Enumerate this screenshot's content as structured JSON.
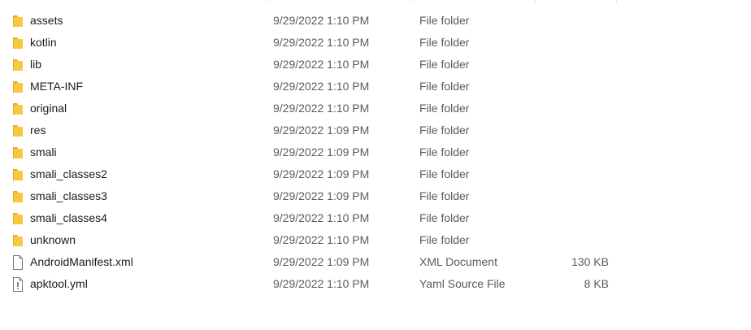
{
  "files": [
    {
      "icon": "folder-icon",
      "name": "assets",
      "date": "9/29/2022 1:10 PM",
      "type": "File folder",
      "size": ""
    },
    {
      "icon": "folder-icon",
      "name": "kotlin",
      "date": "9/29/2022 1:10 PM",
      "type": "File folder",
      "size": ""
    },
    {
      "icon": "folder-icon",
      "name": "lib",
      "date": "9/29/2022 1:10 PM",
      "type": "File folder",
      "size": ""
    },
    {
      "icon": "folder-icon",
      "name": "META-INF",
      "date": "9/29/2022 1:10 PM",
      "type": "File folder",
      "size": ""
    },
    {
      "icon": "folder-icon",
      "name": "original",
      "date": "9/29/2022 1:10 PM",
      "type": "File folder",
      "size": ""
    },
    {
      "icon": "folder-icon",
      "name": "res",
      "date": "9/29/2022 1:09 PM",
      "type": "File folder",
      "size": ""
    },
    {
      "icon": "folder-icon",
      "name": "smali",
      "date": "9/29/2022 1:09 PM",
      "type": "File folder",
      "size": ""
    },
    {
      "icon": "folder-icon",
      "name": "smali_classes2",
      "date": "9/29/2022 1:09 PM",
      "type": "File folder",
      "size": ""
    },
    {
      "icon": "folder-icon",
      "name": "smali_classes3",
      "date": "9/29/2022 1:09 PM",
      "type": "File folder",
      "size": ""
    },
    {
      "icon": "folder-icon",
      "name": "smali_classes4",
      "date": "9/29/2022 1:10 PM",
      "type": "File folder",
      "size": ""
    },
    {
      "icon": "folder-icon",
      "name": "unknown",
      "date": "9/29/2022 1:10 PM",
      "type": "File folder",
      "size": ""
    },
    {
      "icon": "document-icon",
      "name": "AndroidManifest.xml",
      "date": "9/29/2022 1:09 PM",
      "type": "XML Document",
      "size": "130 KB"
    },
    {
      "icon": "yaml-file-icon",
      "name": "apktool.yml",
      "date": "9/29/2022 1:10 PM",
      "type": "Yaml Source File",
      "size": "8 KB"
    }
  ],
  "colors": {
    "folder_fill": "#f8c93e",
    "folder_back": "#e6a92c",
    "primary_text": "#1b1b1b",
    "secondary_text": "#5b5b5b"
  }
}
